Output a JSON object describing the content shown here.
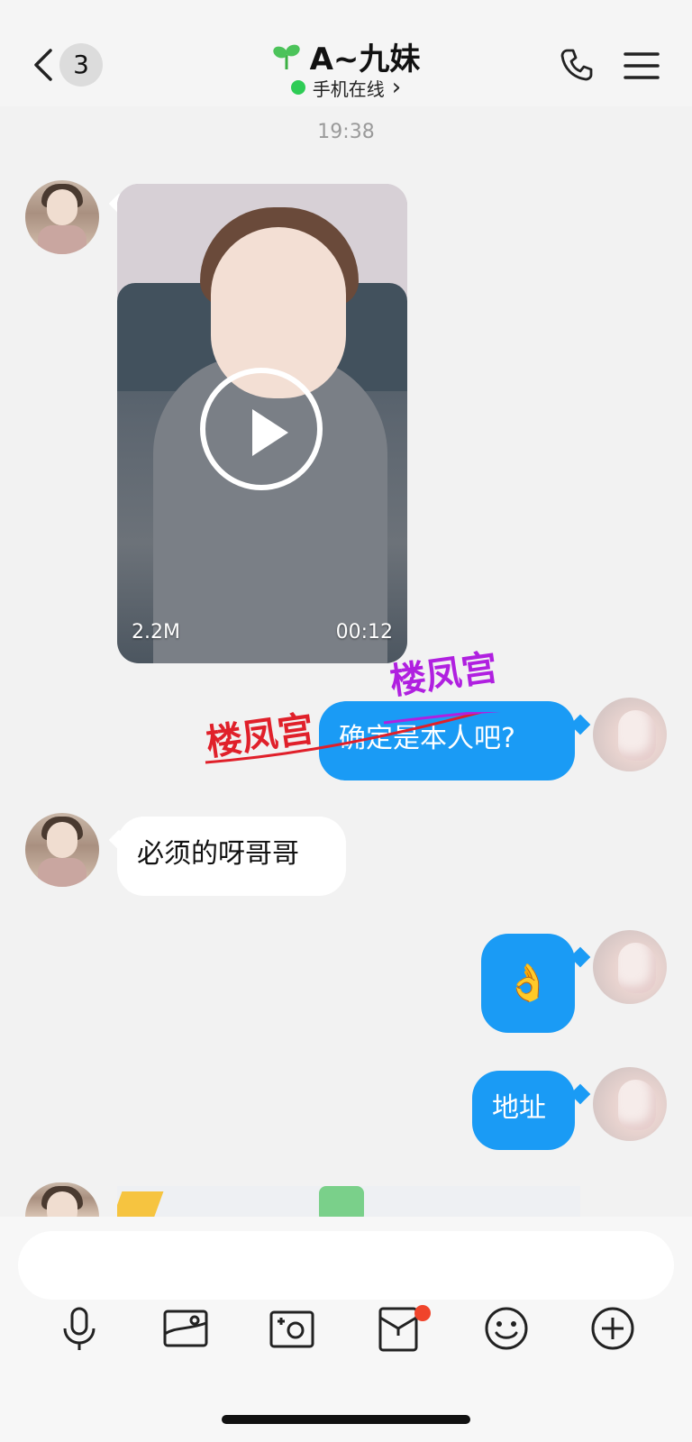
{
  "header": {
    "unread_count": "3",
    "contact_name": "A~九妹",
    "status_text": "手机在线",
    "status_chevron": "›"
  },
  "chat": {
    "timestamp": "19:38",
    "video": {
      "size": "2.2M",
      "duration": "00:12"
    },
    "messages": [
      {
        "from": "me",
        "text": "确定是本人吧?"
      },
      {
        "from": "them",
        "text": "必须的呀哥哥"
      },
      {
        "from": "me",
        "text": "👌"
      },
      {
        "from": "me",
        "text": "地址"
      }
    ],
    "watermark": [
      "楼凤宫",
      "楼凤宫"
    ]
  },
  "input": {
    "placeholder": ""
  },
  "colors": {
    "bubble_out": "#1a9bf5",
    "bubble_in": "#ffffff",
    "online_dot": "#2ecc55",
    "notification_dot": "#f0442b"
  }
}
